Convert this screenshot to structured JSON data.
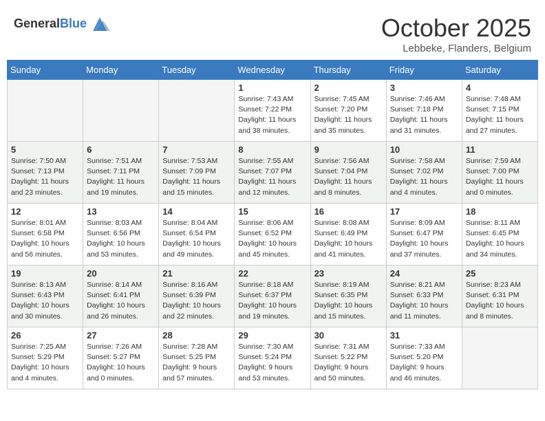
{
  "header": {
    "logo_general": "General",
    "logo_blue": "Blue",
    "month_title": "October 2025",
    "location": "Lebbeke, Flanders, Belgium"
  },
  "weekdays": [
    "Sunday",
    "Monday",
    "Tuesday",
    "Wednesday",
    "Thursday",
    "Friday",
    "Saturday"
  ],
  "weeks": [
    [
      {
        "day": "",
        "info": ""
      },
      {
        "day": "",
        "info": ""
      },
      {
        "day": "",
        "info": ""
      },
      {
        "day": "1",
        "info": "Sunrise: 7:43 AM\nSunset: 7:22 PM\nDaylight: 11 hours\nand 38 minutes."
      },
      {
        "day": "2",
        "info": "Sunrise: 7:45 AM\nSunset: 7:20 PM\nDaylight: 11 hours\nand 35 minutes."
      },
      {
        "day": "3",
        "info": "Sunrise: 7:46 AM\nSunset: 7:18 PM\nDaylight: 11 hours\nand 31 minutes."
      },
      {
        "day": "4",
        "info": "Sunrise: 7:48 AM\nSunset: 7:15 PM\nDaylight: 11 hours\nand 27 minutes."
      }
    ],
    [
      {
        "day": "5",
        "info": "Sunrise: 7:50 AM\nSunset: 7:13 PM\nDaylight: 11 hours\nand 23 minutes."
      },
      {
        "day": "6",
        "info": "Sunrise: 7:51 AM\nSunset: 7:11 PM\nDaylight: 11 hours\nand 19 minutes."
      },
      {
        "day": "7",
        "info": "Sunrise: 7:53 AM\nSunset: 7:09 PM\nDaylight: 11 hours\nand 15 minutes."
      },
      {
        "day": "8",
        "info": "Sunrise: 7:55 AM\nSunset: 7:07 PM\nDaylight: 11 hours\nand 12 minutes."
      },
      {
        "day": "9",
        "info": "Sunrise: 7:56 AM\nSunset: 7:04 PM\nDaylight: 11 hours\nand 8 minutes."
      },
      {
        "day": "10",
        "info": "Sunrise: 7:58 AM\nSunset: 7:02 PM\nDaylight: 11 hours\nand 4 minutes."
      },
      {
        "day": "11",
        "info": "Sunrise: 7:59 AM\nSunset: 7:00 PM\nDaylight: 11 hours\nand 0 minutes."
      }
    ],
    [
      {
        "day": "12",
        "info": "Sunrise: 8:01 AM\nSunset: 6:58 PM\nDaylight: 10 hours\nand 56 minutes."
      },
      {
        "day": "13",
        "info": "Sunrise: 8:03 AM\nSunset: 6:56 PM\nDaylight: 10 hours\nand 53 minutes."
      },
      {
        "day": "14",
        "info": "Sunrise: 8:04 AM\nSunset: 6:54 PM\nDaylight: 10 hours\nand 49 minutes."
      },
      {
        "day": "15",
        "info": "Sunrise: 8:06 AM\nSunset: 6:52 PM\nDaylight: 10 hours\nand 45 minutes."
      },
      {
        "day": "16",
        "info": "Sunrise: 8:08 AM\nSunset: 6:49 PM\nDaylight: 10 hours\nand 41 minutes."
      },
      {
        "day": "17",
        "info": "Sunrise: 8:09 AM\nSunset: 6:47 PM\nDaylight: 10 hours\nand 37 minutes."
      },
      {
        "day": "18",
        "info": "Sunrise: 8:11 AM\nSunset: 6:45 PM\nDaylight: 10 hours\nand 34 minutes."
      }
    ],
    [
      {
        "day": "19",
        "info": "Sunrise: 8:13 AM\nSunset: 6:43 PM\nDaylight: 10 hours\nand 30 minutes."
      },
      {
        "day": "20",
        "info": "Sunrise: 8:14 AM\nSunset: 6:41 PM\nDaylight: 10 hours\nand 26 minutes."
      },
      {
        "day": "21",
        "info": "Sunrise: 8:16 AM\nSunset: 6:39 PM\nDaylight: 10 hours\nand 22 minutes."
      },
      {
        "day": "22",
        "info": "Sunrise: 8:18 AM\nSunset: 6:37 PM\nDaylight: 10 hours\nand 19 minutes."
      },
      {
        "day": "23",
        "info": "Sunrise: 8:19 AM\nSunset: 6:35 PM\nDaylight: 10 hours\nand 15 minutes."
      },
      {
        "day": "24",
        "info": "Sunrise: 8:21 AM\nSunset: 6:33 PM\nDaylight: 10 hours\nand 11 minutes."
      },
      {
        "day": "25",
        "info": "Sunrise: 8:23 AM\nSunset: 6:31 PM\nDaylight: 10 hours\nand 8 minutes."
      }
    ],
    [
      {
        "day": "26",
        "info": "Sunrise: 7:25 AM\nSunset: 5:29 PM\nDaylight: 10 hours\nand 4 minutes."
      },
      {
        "day": "27",
        "info": "Sunrise: 7:26 AM\nSunset: 5:27 PM\nDaylight: 10 hours\nand 0 minutes."
      },
      {
        "day": "28",
        "info": "Sunrise: 7:28 AM\nSunset: 5:25 PM\nDaylight: 9 hours\nand 57 minutes."
      },
      {
        "day": "29",
        "info": "Sunrise: 7:30 AM\nSunset: 5:24 PM\nDaylight: 9 hours\nand 53 minutes."
      },
      {
        "day": "30",
        "info": "Sunrise: 7:31 AM\nSunset: 5:22 PM\nDaylight: 9 hours\nand 50 minutes."
      },
      {
        "day": "31",
        "info": "Sunrise: 7:33 AM\nSunset: 5:20 PM\nDaylight: 9 hours\nand 46 minutes."
      },
      {
        "day": "",
        "info": ""
      }
    ]
  ]
}
